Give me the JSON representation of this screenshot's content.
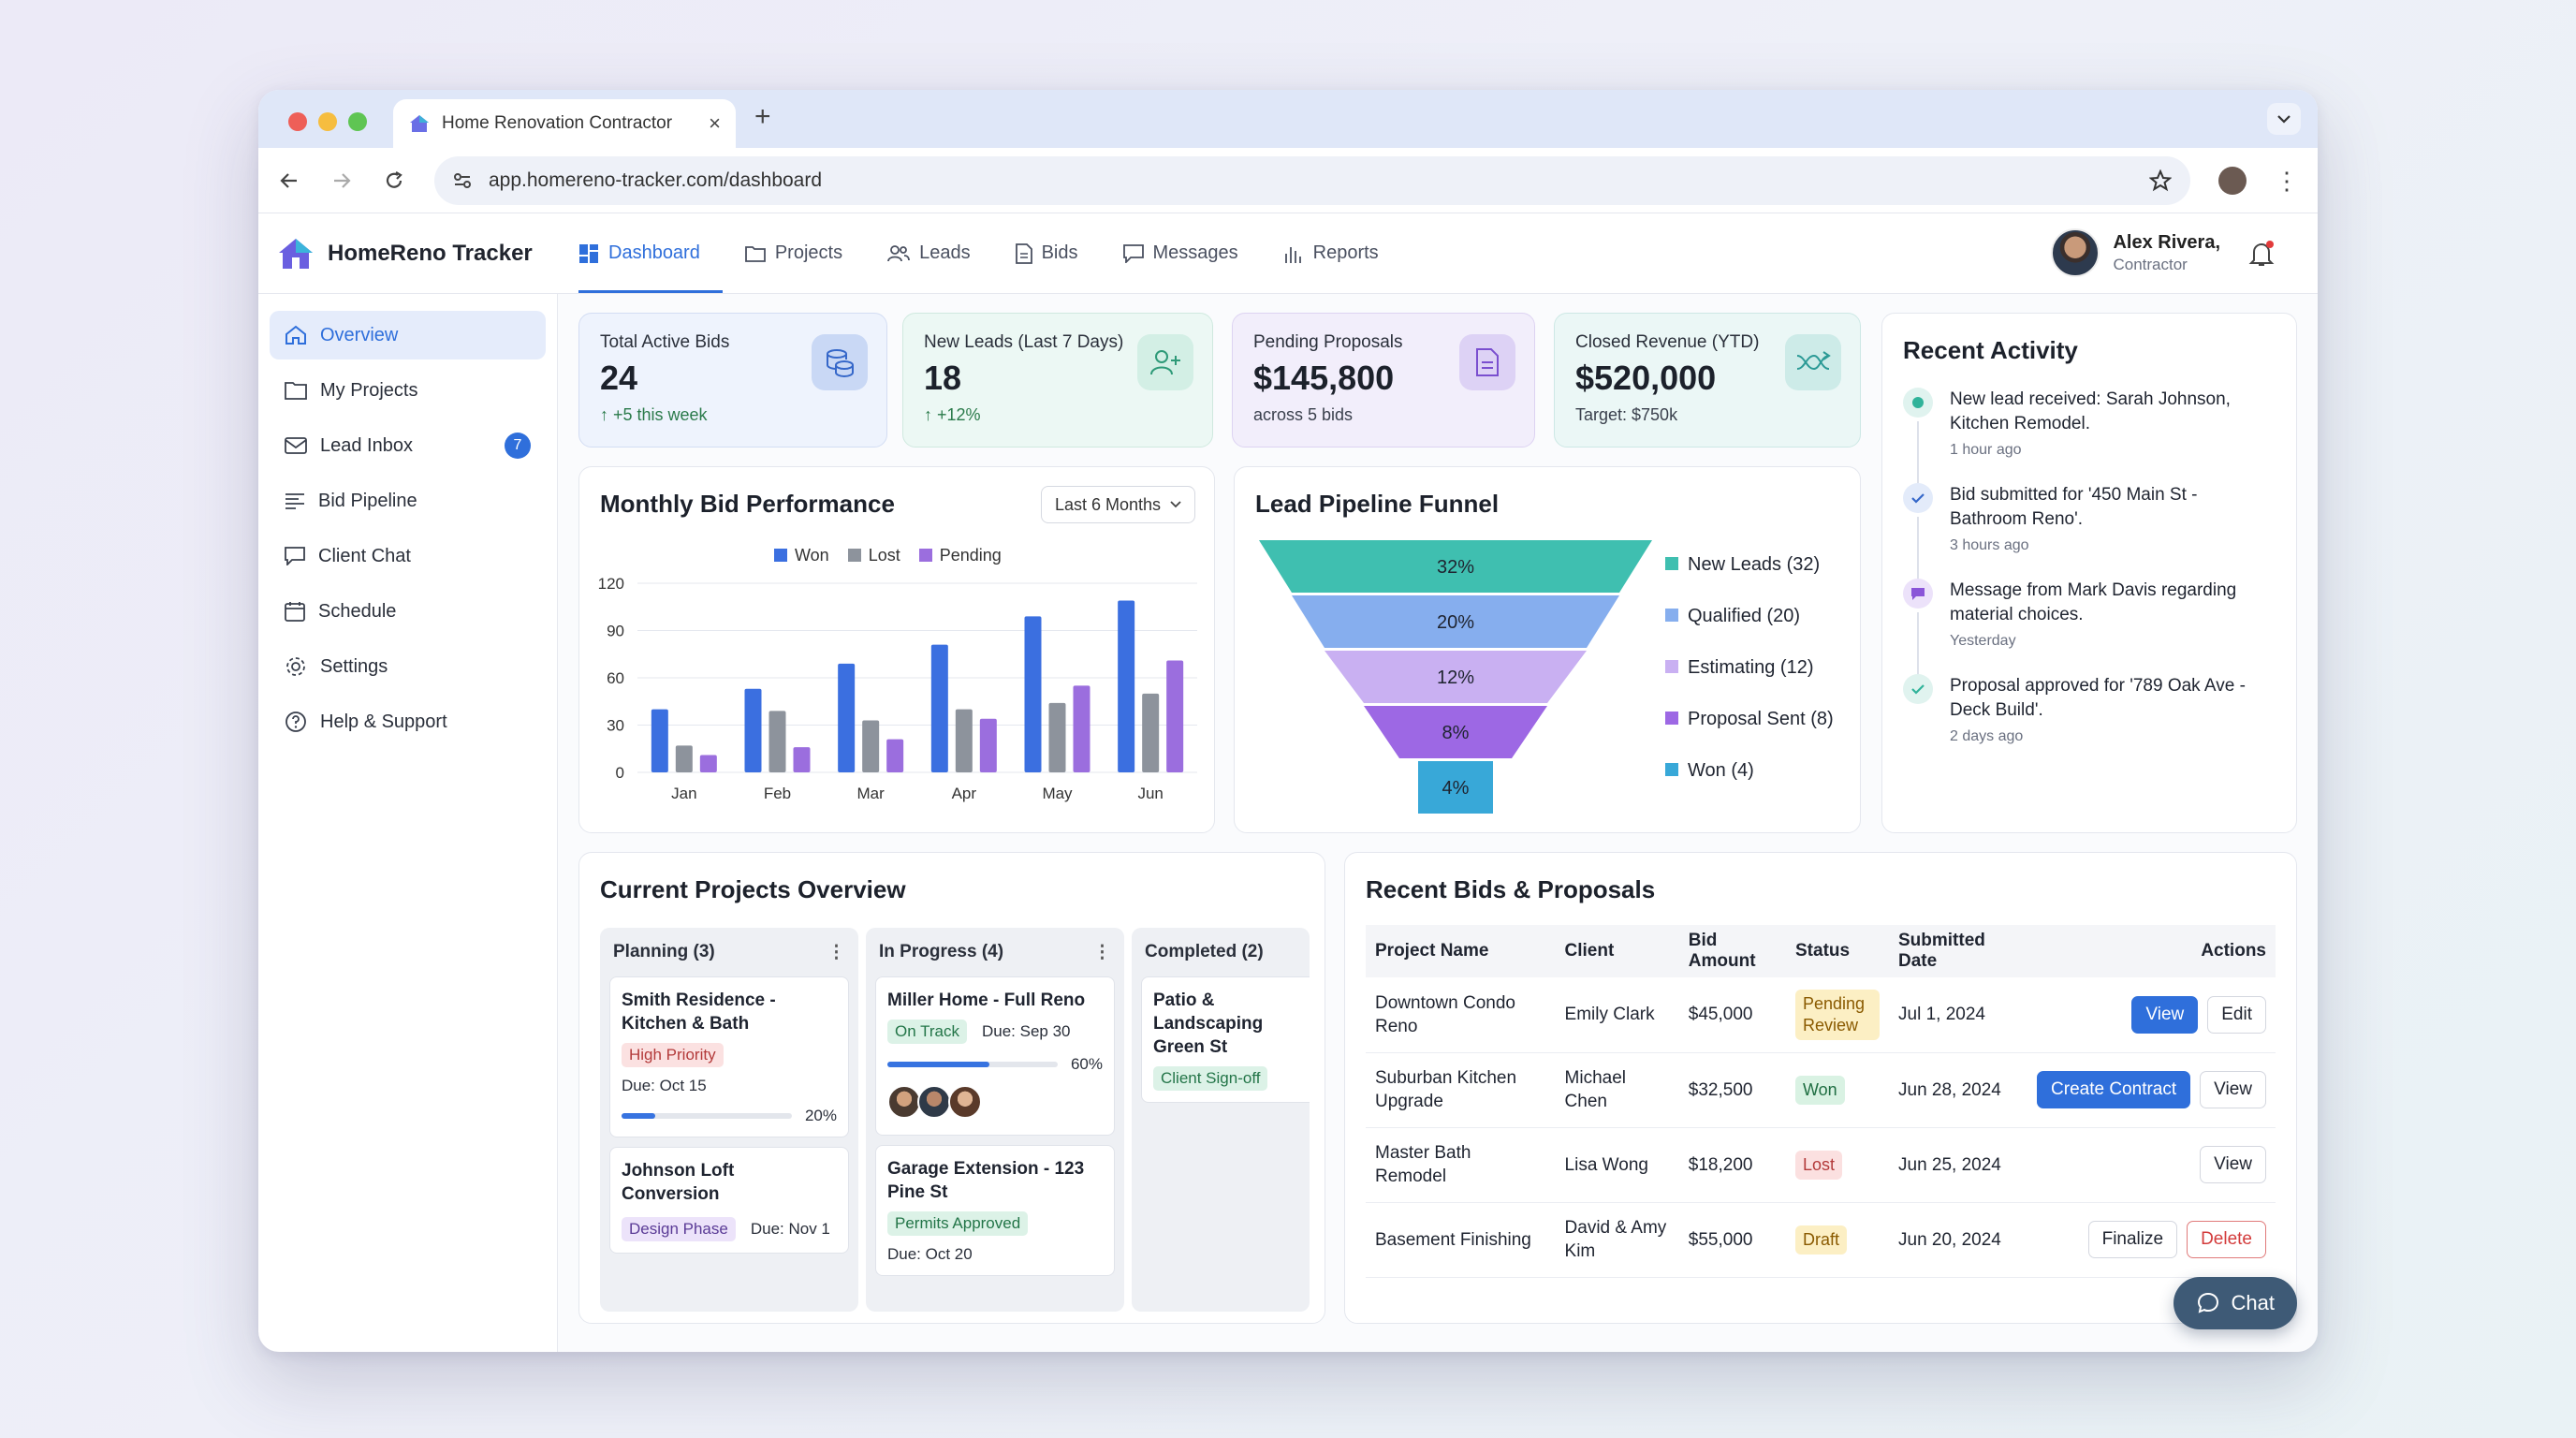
{
  "browser": {
    "tab_title": "Home Renovation Contractor",
    "url": "app.homereno-tracker.com/dashboard"
  },
  "app": {
    "brand": "HomeReno Tracker",
    "nav": [
      {
        "label": "Dashboard",
        "icon": "dashboard-icon"
      },
      {
        "label": "Projects",
        "icon": "folder-icon"
      },
      {
        "label": "Leads",
        "icon": "users-icon"
      },
      {
        "label": "Bids",
        "icon": "document-icon"
      },
      {
        "label": "Messages",
        "icon": "message-icon"
      },
      {
        "label": "Reports",
        "icon": "bar-chart-icon"
      }
    ],
    "user": {
      "name": "Alex Rivera,",
      "role": "Contractor"
    }
  },
  "sidebar": {
    "items": [
      {
        "label": "Overview",
        "icon": "home-icon"
      },
      {
        "label": "My Projects",
        "icon": "folder-icon"
      },
      {
        "label": "Lead Inbox",
        "icon": "inbox-icon",
        "badge": "7"
      },
      {
        "label": "Bid Pipeline",
        "icon": "list-icon"
      },
      {
        "label": "Client Chat",
        "icon": "chat-icon"
      },
      {
        "label": "Schedule",
        "icon": "calendar-icon"
      },
      {
        "label": "Settings",
        "icon": "gear-icon"
      },
      {
        "label": "Help & Support",
        "icon": "help-icon"
      }
    ]
  },
  "stats": [
    {
      "label": "Total Active Bids",
      "value": "24",
      "sub": "↑ +5 this week",
      "icon": "coins-icon"
    },
    {
      "label": "New Leads (Last 7 Days)",
      "value": "18",
      "sub": "↑ +12%",
      "icon": "user-plus-icon"
    },
    {
      "label": "Pending Proposals",
      "value": "$145,800",
      "sub": "across 5 bids",
      "icon": "file-icon"
    },
    {
      "label": "Closed Revenue (YTD)",
      "value": "$520,000",
      "sub": "Target: $750k",
      "icon": "trend-icon"
    }
  ],
  "bid_chart": {
    "title": "Monthly Bid Performance",
    "range_label": "Last 6 Months"
  },
  "funnel": {
    "title": "Lead Pipeline Funnel"
  },
  "chart_data": [
    {
      "type": "bar",
      "title": "Monthly Bid Performance",
      "categories": [
        "Jan",
        "Feb",
        "Mar",
        "Apr",
        "May",
        "Jun"
      ],
      "series": [
        {
          "name": "Won",
          "color": "#3b6fe0",
          "values": [
            40,
            53,
            69,
            81,
            99,
            109
          ]
        },
        {
          "name": "Lost",
          "color": "#8d939c",
          "values": [
            17,
            39,
            33,
            40,
            44,
            50
          ]
        },
        {
          "name": "Pending",
          "color": "#9b6ede",
          "values": [
            11,
            16,
            21,
            34,
            55,
            71
          ]
        }
      ],
      "yticks": [
        0,
        30,
        60,
        90,
        120
      ],
      "ylim": [
        0,
        120
      ],
      "legend": "top"
    },
    {
      "type": "funnel",
      "title": "Lead Pipeline Funnel",
      "stages": [
        {
          "label": "32%",
          "legend": "New Leads (32)",
          "color": "#3fbfb0"
        },
        {
          "label": "20%",
          "legend": "Qualified (20)",
          "color": "#86aeee"
        },
        {
          "label": "12%",
          "legend": "Estimating (12)",
          "color": "#c9b0f2"
        },
        {
          "label": "8%",
          "legend": "Proposal Sent (8)",
          "color": "#9d68e4"
        },
        {
          "label": "4%",
          "legend": "Won (4)",
          "color": "#38a8d8"
        }
      ]
    }
  ],
  "activity": {
    "title": "Recent Activity",
    "items": [
      {
        "text": "New lead received: Sarah Johnson, Kitchen Remodel.",
        "time": "1 hour ago",
        "icon": "dot-icon"
      },
      {
        "text": "Bid submitted for '450 Main St - Bathroom Reno'.",
        "time": "3 hours ago",
        "icon": "check-icon"
      },
      {
        "text": "Message from Mark Davis regarding material choices.",
        "time": "Yesterday",
        "icon": "message-icon"
      },
      {
        "text": "Proposal approved for '789 Oak Ave - Deck Build'.",
        "time": "2 days ago",
        "icon": "check-icon"
      }
    ]
  },
  "projects": {
    "title": "Current Projects Overview",
    "columns": [
      {
        "title": "Planning (3)",
        "cards": [
          {
            "title": "Smith Residence - Kitchen & Bath",
            "tag": "High Priority",
            "due": "Due: Oct 15",
            "progress": 0.2,
            "progress_label": "20%"
          },
          {
            "title": "Johnson Loft Conversion",
            "tag": "Design Phase",
            "due": "Due: Nov 1"
          }
        ]
      },
      {
        "title": "In Progress (4)",
        "cards": [
          {
            "title": "Miller Home - Full Reno",
            "tag": "On Track",
            "due": "Due: Sep 30",
            "progress": 0.6,
            "progress_label": "60%"
          },
          {
            "title": "Garage Extension - 123 Pine St",
            "tag": "Permits Approved",
            "due": "Due: Oct 20"
          }
        ]
      },
      {
        "title": "Completed (2)",
        "cards": [
          {
            "title": "Patio & Landscaping Green St",
            "tag": "Client Sign-off"
          }
        ]
      }
    ]
  },
  "bids": {
    "title": "Recent Bids & Proposals",
    "headers": [
      "Project Name",
      "Client",
      "Bid Amount",
      "Status",
      "Submitted Date",
      "Actions"
    ],
    "rows": [
      {
        "project": "Downtown Condo Reno",
        "client": "Emily Clark",
        "amount": "$45,000",
        "status": "Pending Review",
        "date": "Jul 1, 2024",
        "actions": [
          "View",
          "Edit"
        ]
      },
      {
        "project": "Suburban Kitchen Upgrade",
        "client": "Michael Chen",
        "amount": "$32,500",
        "status": "Won",
        "date": "Jun 28, 2024",
        "actions": [
          "Create Contract",
          "View"
        ]
      },
      {
        "project": "Master Bath Remodel",
        "client": "Lisa Wong",
        "amount": "$18,200",
        "status": "Lost",
        "date": "Jun 25, 2024",
        "actions": [
          "View"
        ]
      },
      {
        "project": "Basement Finishing",
        "client": "David & Amy Kim",
        "amount": "$55,000",
        "status": "Draft",
        "date": "Jun 20, 2024",
        "actions": [
          "Finalize",
          "Delete"
        ]
      }
    ]
  },
  "chat": {
    "label": "Chat"
  }
}
